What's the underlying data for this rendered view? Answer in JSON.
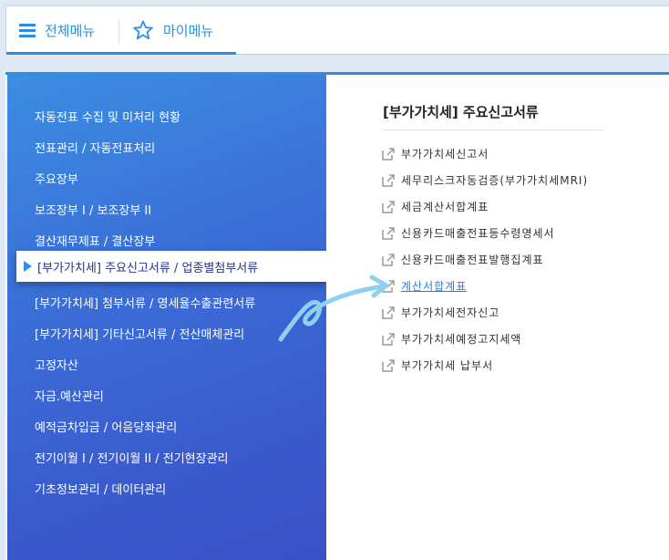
{
  "tabs": {
    "all_menu_label": "전체메뉴",
    "my_menu_label": "마이메뉴"
  },
  "sidebar": {
    "items": [
      "자동전표 수집 및 미처리 현황",
      "전표관리 / 자동전표처리",
      "주요장부",
      "보조장부 I / 보조장부 II",
      "결산재무제표 / 결산장부",
      "[부가가치세] 주요신고서류 / 업종별첨부서류",
      "[부가가치세] 첨부서류 / 영세율수출관련서류",
      "[부가가치세] 기타신고서류 / 전산매체관리",
      "고정자산",
      "자금.예산관리",
      "예적금차입금 / 어음당좌관리",
      "전기이월 I / 전기이월 II / 전기현장관리",
      "기초정보관리 / 데이터관리"
    ],
    "active_index": 5
  },
  "content": {
    "title": "[부가가치세] 주요신고서류",
    "items": [
      "부가가치세신고서",
      "세무리스크자동검증(부가가치세MRI)",
      "세금계산서합계표",
      "신용카드매출전표등수령명세서",
      "신용카드매출전표발행집계표",
      "계산서합계표",
      "부가가치세전자신고",
      "부가가치세예정고지세액",
      "부가가치세 납부서"
    ],
    "hovered_index": 5
  },
  "icons": {
    "all_menu": "hamburger-icon",
    "my_menu": "star-icon",
    "doc": "external-link-icon",
    "active": "caret-right-icon",
    "annotation": "curved-arrow-icon"
  },
  "colors": {
    "accent": "#2e8fe0",
    "sidebar_top": "#3b8de2",
    "sidebar_bottom": "#3a4fc6",
    "link_hover": "#2f7fd8",
    "annotation": "#8fd0f2"
  }
}
